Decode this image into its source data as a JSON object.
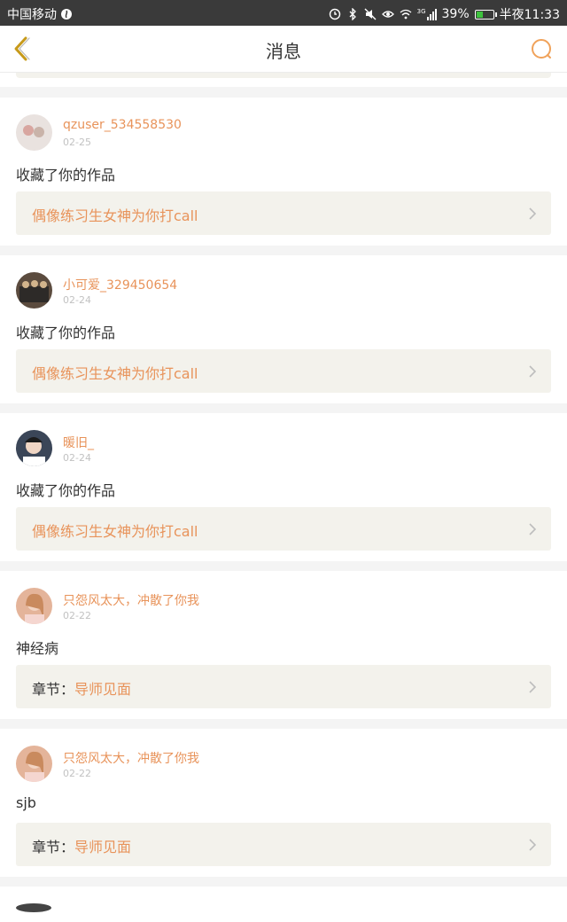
{
  "status_bar": {
    "carrier": "中国移动",
    "network": "3G",
    "battery": "39%",
    "battery_level": 0.39,
    "time": "半夜11:33"
  },
  "header": {
    "title": "消息",
    "back_icon": "chevron-left-icon",
    "search_icon": "search-icon"
  },
  "colors": {
    "accent": "#e8935a",
    "back": "#c79a1a",
    "ref_bg": "#f3f2ec"
  },
  "messages": [
    {
      "user": "qzuser_534558530",
      "date": "02-25",
      "content": "收藏了你的作品",
      "ref_prefix": "",
      "ref_title": "偶像练习生女神为你打call",
      "avatar_bg": "#e9e2df"
    },
    {
      "user": "小可爱_329450654",
      "date": "02-24",
      "content": "收藏了你的作品",
      "ref_prefix": "",
      "ref_title": "偶像练习生女神为你打call",
      "avatar_bg": "#5b4b3e"
    },
    {
      "user": "暖旧_",
      "date": "02-24",
      "content": "收藏了你的作品",
      "ref_prefix": "",
      "ref_title": "偶像练习生女神为你打call",
      "avatar_bg": "#3b4658"
    },
    {
      "user": "只怨风太大，冲散了你我",
      "date": "02-22",
      "content": "神经病",
      "ref_prefix": "章节：",
      "ref_title": "导师见面",
      "avatar_bg": "#e4b49a"
    },
    {
      "user": "只怨风太大，冲散了你我",
      "date": "02-22",
      "content": "sjb",
      "ref_prefix": "章节：",
      "ref_title": "导师见面",
      "avatar_bg": "#e4b49a"
    }
  ]
}
